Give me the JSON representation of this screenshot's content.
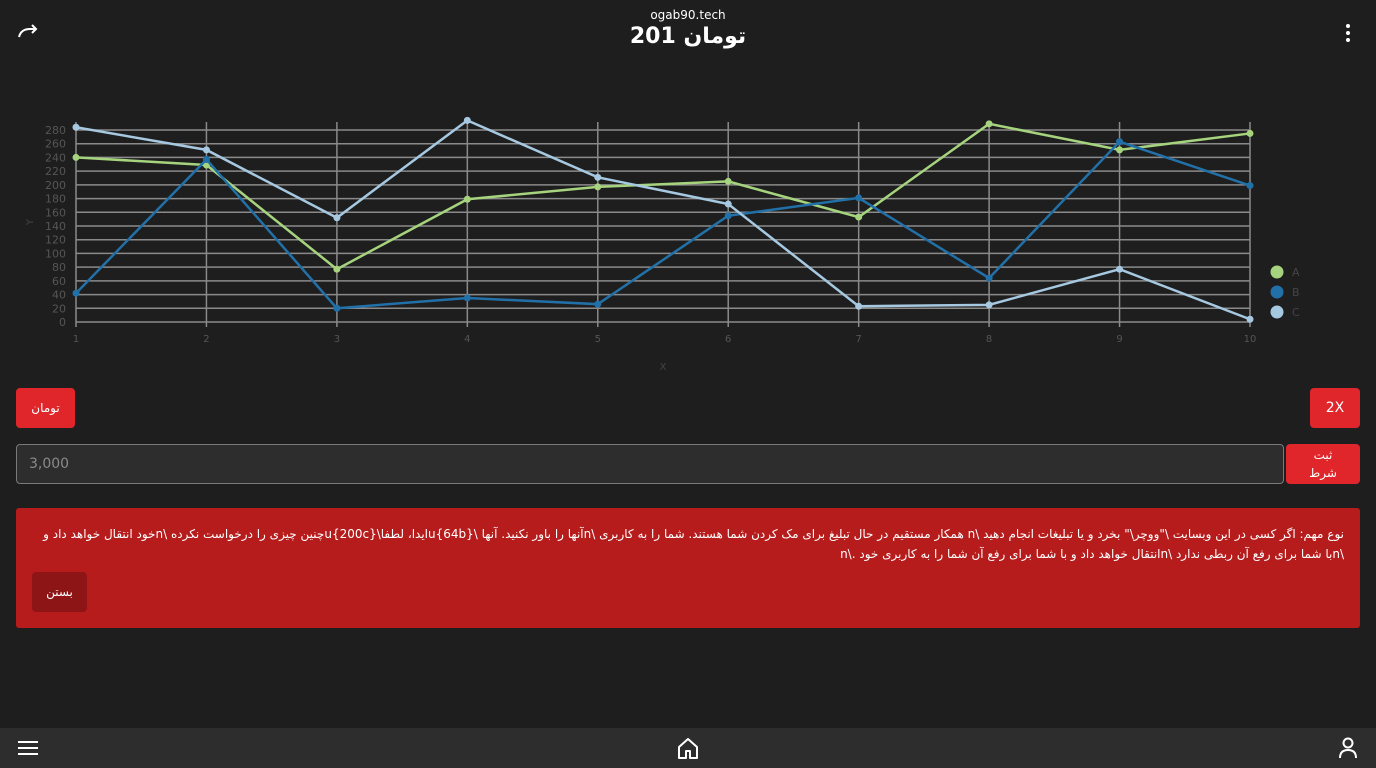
{
  "header": {
    "domain": "ogab90.tech",
    "title": "201 تومان"
  },
  "icons": {
    "refresh": "refresh-icon",
    "more": "more-vertical-icon",
    "menu": "menu-icon",
    "home": "home-icon",
    "user": "user-icon"
  },
  "chart_data": {
    "type": "line",
    "x": [
      1,
      2,
      3,
      4,
      5,
      6,
      7,
      8,
      9,
      10
    ],
    "series": [
      {
        "name": "A",
        "color": "#a6d37d",
        "values": [
          240,
          229,
          77,
          179,
          197,
          205,
          153,
          289,
          251,
          275
        ]
      },
      {
        "name": "B",
        "color": "#2270a8",
        "values": [
          42,
          237,
          20,
          35,
          26,
          155,
          181,
          64,
          263,
          199
        ]
      },
      {
        "name": "C",
        "color": "#a6c8e0",
        "values": [
          284,
          251,
          152,
          294,
          211,
          172,
          23,
          25,
          77,
          4
        ]
      }
    ],
    "xlabel": "X",
    "ylabel": "Y",
    "xlim": [
      1,
      10
    ],
    "ylim": [
      0,
      280
    ],
    "yticks": [
      0,
      20,
      40,
      60,
      80,
      100,
      120,
      140,
      160,
      180,
      200,
      220,
      240,
      260,
      280
    ],
    "grid": true,
    "legend_position": "right"
  },
  "controls": {
    "toman_label": "تومان",
    "x2_label": "2X",
    "bet_placeholder": "3,000",
    "submit_label_line1": "ثبت",
    "submit_label_line2": "شرط"
  },
  "alert": {
    "text": "نوع مهم: اگر کسی در این وبسایت \\\"ووچر\\\" بخرد و یا تبلیغات انجام دهید \\n همکار مستقیم در حال تبلیغ برای مک کردن شما هستند. شما را به کاربری \\nآنها را باور نکنید. آنها \\u{64b}ایدا، لطفا\\u{200c}چنین چیزی را درخواست نکرده \\nخود انتقال خواهد داد و \\nبا شما برای رفع آن ربطی ندارد \\nانتقال خواهد داد و با شما برای رفع آن شما را به کاربری خود .\\n",
    "close_label": "بستن"
  },
  "colors": {
    "background": "#1e1e1e",
    "accent_red": "#e0262a",
    "alert_red": "#b71c1c",
    "nav_bg": "#2d2d2d"
  }
}
